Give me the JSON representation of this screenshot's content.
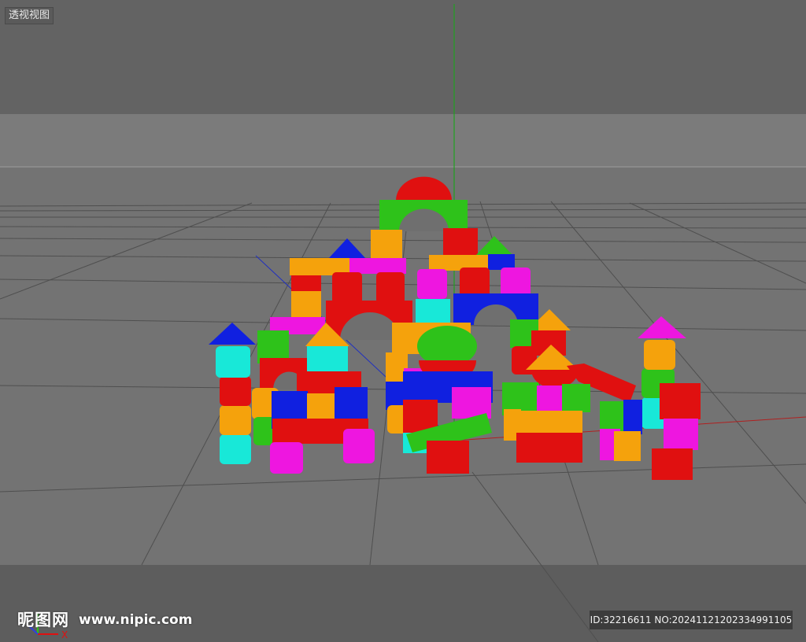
{
  "viewport": {
    "view_name": "透视视图"
  },
  "axis_gizmo": {
    "x_label": "X"
  },
  "watermark": {
    "site_name": "昵图网",
    "url": "www.nipic.com",
    "id_text": "ID:32216611 NO:20241121202334991105"
  },
  "colors": {
    "red": "#e01010",
    "green": "#2ec21a",
    "blue": "#1020e0",
    "orange": "#f5a20c",
    "magenta": "#ee16e0",
    "cyan": "#18e8d8",
    "grid_line": "#4a4a4a",
    "axis_y": "#1fa11f",
    "axis_x": "#c02020"
  }
}
